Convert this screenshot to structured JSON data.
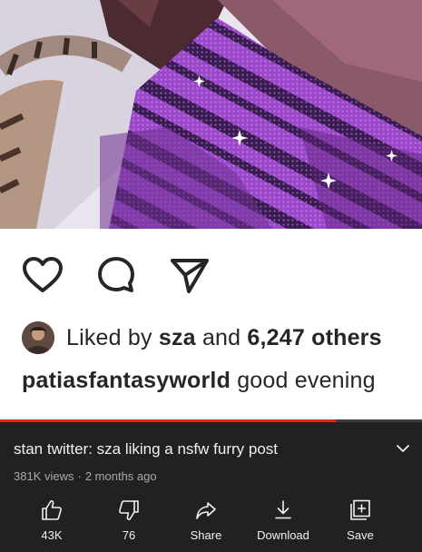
{
  "post": {
    "liked_prefix": "Liked by ",
    "liked_user": "sza",
    "liked_and": " and ",
    "liked_count": "6,247 others",
    "caption_user": "patiasfantasyworld",
    "caption_text": " good evening"
  },
  "player": {
    "progress": 0.795
  },
  "video": {
    "title": "stan twitter: sza liking a nsfw furry post",
    "views": "381K views",
    "separator": "·",
    "age": "2 months ago"
  },
  "actions": {
    "like_count": "43K",
    "dislike_count": "76",
    "share_label": "Share",
    "download_label": "Download",
    "save_label": "Save"
  },
  "colors": {
    "accent": "#e62117",
    "background": "#212121"
  }
}
